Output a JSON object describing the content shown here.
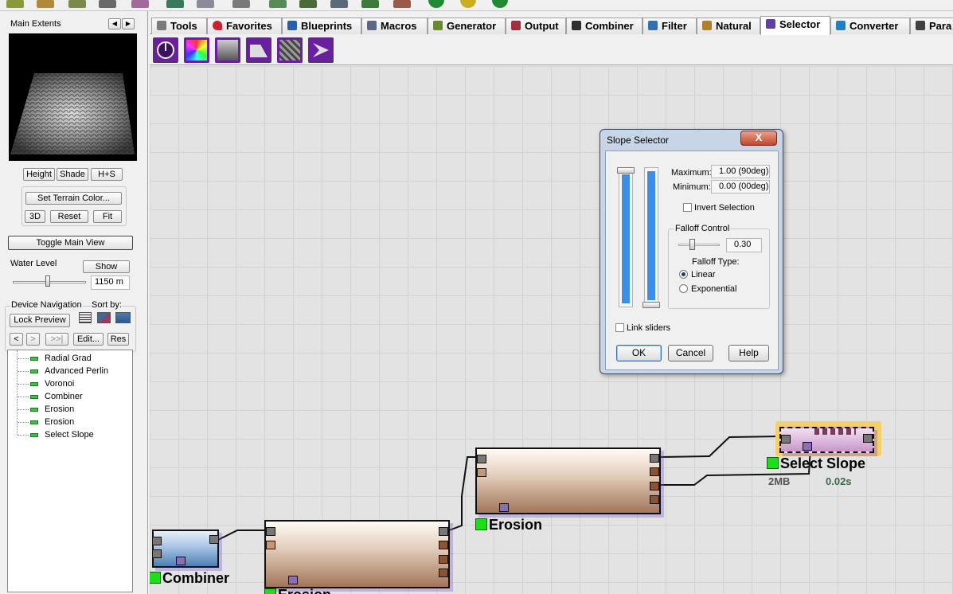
{
  "left_panel": {
    "main_extents_label": "Main Extents",
    "view_buttons": [
      "Height",
      "Shade",
      "H+S"
    ],
    "set_terrain_color": "Set Terrain Color...",
    "nav_buttons": [
      "3D",
      "Reset",
      "Fit"
    ],
    "toggle_main_view": "Toggle Main View",
    "water_level": {
      "label": "Water Level",
      "show": "Show",
      "value": "1150 m",
      "level": 0.42
    },
    "device_navigation": {
      "label": "Device Navigation",
      "sort_by": "Sort by:",
      "lock_preview": "Lock Preview",
      "prev": "<",
      "next": ">",
      "last": ">>|",
      "edit": "Edit...",
      "res": "Res"
    },
    "tree_items": [
      "Radial Grad",
      "Advanced Perlin",
      "Voronoi",
      "Combiner",
      "Erosion",
      "Erosion",
      "Select Slope"
    ]
  },
  "tabs": [
    {
      "label": "Tools",
      "color": "#7a7a7a"
    },
    {
      "label": "Favorites",
      "color": "#d02030"
    },
    {
      "label": "Blueprints",
      "color": "#2a5fb0"
    },
    {
      "label": "Macros",
      "color": "#5a6a80"
    },
    {
      "label": "Generator",
      "color": "#6a8a30"
    },
    {
      "label": "Output",
      "color": "#a03040"
    },
    {
      "label": "Combiner",
      "color": "#303030"
    },
    {
      "label": "Filter",
      "color": "#3070b0"
    },
    {
      "label": "Natural",
      "color": "#b08030"
    },
    {
      "label": "Selector",
      "color": "#6040a0"
    },
    {
      "label": "Converter",
      "color": "#2080c0"
    },
    {
      "label": "Para",
      "color": "#404040"
    }
  ],
  "active_tab": "Selector",
  "dialog": {
    "title": "Slope Selector",
    "close": "X",
    "maximum_label": "Maximum:",
    "maximum_value": "1.00 (90deg)",
    "minimum_label": "Minimum:",
    "minimum_value": "0.00 (00deg)",
    "invert_selection": "Invert Selection",
    "falloff_control": "Falloff Control",
    "falloff_value": "0.30",
    "falloff_type": "Falloff Type:",
    "linear": "Linear",
    "exponential": "Exponential",
    "link_sliders": "Link sliders",
    "ok": "OK",
    "cancel": "Cancel",
    "help": "Help"
  },
  "nodes": {
    "combiner": "Combiner",
    "erosion_1": "Erosion",
    "erosion_2": "Erosion",
    "select_slope": "Select Slope",
    "select_slope_mem": "2MB",
    "select_slope_time": "0.02s"
  }
}
